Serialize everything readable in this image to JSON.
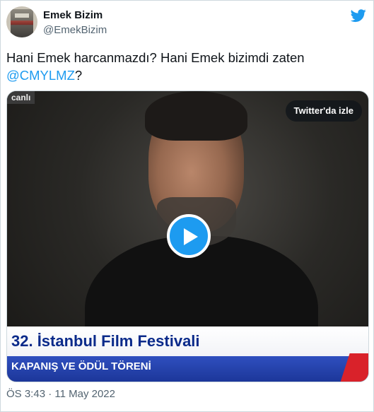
{
  "author": {
    "name": "Emek Bizim",
    "handle": "@EmekBizim"
  },
  "tweet": {
    "text_before": "Hani Emek harcanmazdı? Hani Emek bizimdi zaten ",
    "mention": "@CMYLMZ",
    "text_after": "?"
  },
  "media": {
    "channel_logo": "canlı",
    "watch_label": "Twitter'da izle",
    "lower_third_title": "32. İstanbul Film Festivali",
    "lower_third_subtitle": "KAPANIŞ VE ÖDÜL TÖRENİ"
  },
  "footer": {
    "timestamp": "ÖS 3:43 · 11 May 2022"
  },
  "colors": {
    "accent": "#1d9bf0",
    "secondary_text": "#536471"
  },
  "icons": {
    "brand": "twitter-bird-icon",
    "play": "play-icon"
  }
}
